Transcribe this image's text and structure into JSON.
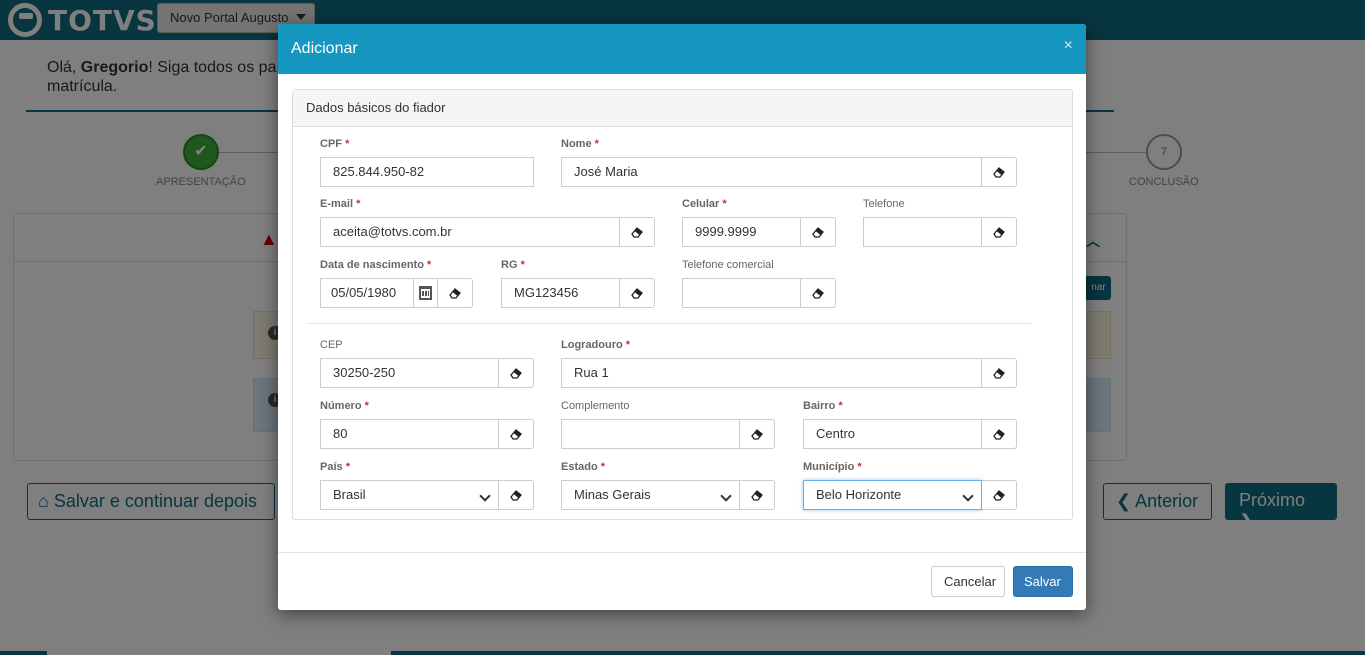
{
  "header": {
    "brand": "TOTVS",
    "portal_select": "Novo Portal Augusto"
  },
  "greeting": {
    "prefix": "Olá, ",
    "name": "Gregorio",
    "suffix": "! Siga todos os pa",
    "line2": "matrícula."
  },
  "steps": {
    "first_label": "APRESENTAÇÃO",
    "last_number": "7",
    "last_label": "CONCLUSÃO"
  },
  "page_buttons": {
    "save_later": "Salvar e continuar depois",
    "previous": "Anterior",
    "next": "Próximo",
    "small_btn_text": "nar"
  },
  "modal": {
    "title": "Adicionar",
    "close": "×",
    "section_title": "Dados básicos do fiador",
    "fields": {
      "cpf": {
        "label": "CPF",
        "value": "825.844.950-82"
      },
      "nome": {
        "label": "Nome",
        "value": "José Maria"
      },
      "email": {
        "label": "E-mail",
        "value": "aceita@totvs.com.br"
      },
      "celular": {
        "label": "Celular",
        "value": "9999.9999"
      },
      "telefone": {
        "label": "Telefone",
        "value": ""
      },
      "nascimento": {
        "label": "Data de nascimento",
        "value": "05/05/1980"
      },
      "rg": {
        "label": "RG",
        "value": "MG123456"
      },
      "tel_comercial": {
        "label": "Telefone comercial",
        "value": ""
      },
      "cep": {
        "label": "CEP",
        "value": "30250-250"
      },
      "logradouro": {
        "label": "Logradouro",
        "value": "Rua 1"
      },
      "numero": {
        "label": "Número",
        "value": "80"
      },
      "complemento": {
        "label": "Complemento",
        "value": ""
      },
      "bairro": {
        "label": "Bairro",
        "value": "Centro"
      },
      "pais": {
        "label": "País",
        "value": "Brasil"
      },
      "estado": {
        "label": "Estado",
        "value": "Minas Gerais"
      },
      "municipio": {
        "label": "Município",
        "value": "Belo Horizonte"
      }
    },
    "required_mark": "*",
    "cancel": "Cancelar",
    "save": "Salvar"
  },
  "icons": {
    "eraser": "eraser-icon",
    "calendar": "calendar-icon",
    "caret": "chevron-down-icon"
  }
}
